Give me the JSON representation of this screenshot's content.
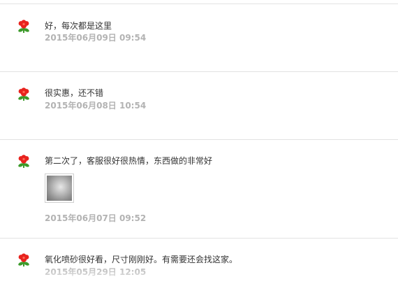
{
  "reviews": [
    {
      "text": "好，每次都是这里",
      "date": "2015年06月09日 09:54"
    },
    {
      "text": "很实惠，还不错",
      "date": "2015年06月08日 10:54"
    },
    {
      "text": "第二次了，客服很好很热情，东西做的非常好",
      "date": "2015年06月07日 09:52",
      "has_photo": true
    },
    {
      "text": "氧化喷砂很好看，尺寸刚刚好。有需要还会找这家。",
      "date": "2015年05月29日 12:05"
    }
  ],
  "icons": {
    "avatar": "red-flower-icon",
    "photo": "review-photo-thumbnail"
  },
  "colors": {
    "flower_red": "#e8231e",
    "leaf_green": "#3c9a2a",
    "date_gray": "#b3b3b3",
    "divider": "#e2e2e2"
  }
}
